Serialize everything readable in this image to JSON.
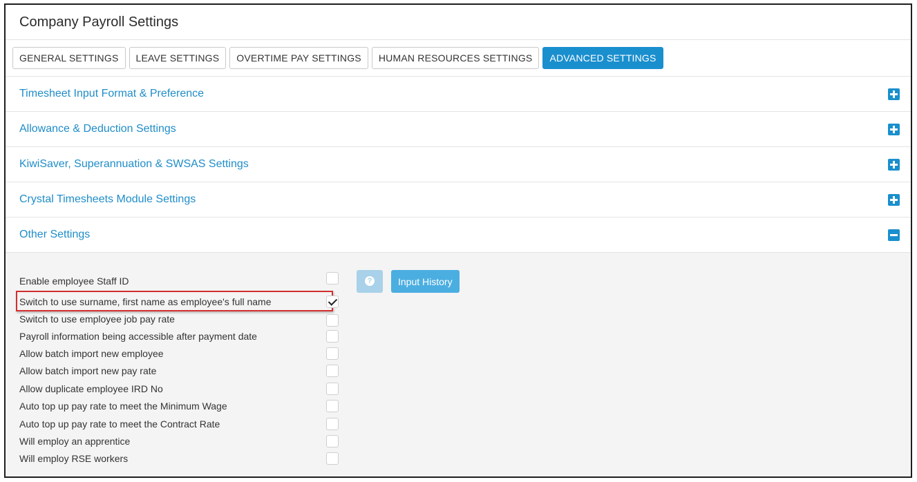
{
  "page": {
    "title": "Company Payroll Settings"
  },
  "tabs": [
    {
      "label": "GENERAL SETTINGS"
    },
    {
      "label": "LEAVE SETTINGS"
    },
    {
      "label": "OVERTIME PAY SETTINGS"
    },
    {
      "label": "HUMAN RESOURCES SETTINGS"
    },
    {
      "label": "ADVANCED SETTINGS",
      "active": true
    }
  ],
  "sections": [
    {
      "title": "Timesheet Input Format & Preference",
      "icon": "plus-icon",
      "expanded": false
    },
    {
      "title": "Allowance & Deduction Settings",
      "icon": "plus-icon",
      "expanded": false
    },
    {
      "title": "KiwiSaver, Superannuation & SWSAS Settings",
      "icon": "plus-icon",
      "expanded": false
    },
    {
      "title": "Crystal Timesheets Module Settings",
      "icon": "plus-icon",
      "expanded": false
    },
    {
      "title": "Other Settings",
      "icon": "minus-icon",
      "expanded": true
    }
  ],
  "other_settings": {
    "help_icon": "question-icon",
    "input_history_label": "Input History",
    "options": [
      {
        "label": "Enable employee Staff ID",
        "checked": false
      },
      {
        "label": "Switch to use surname, first name as employee's full name",
        "checked": true,
        "highlighted": true
      },
      {
        "label": "Switch to use employee job pay rate",
        "checked": false
      },
      {
        "label": "Payroll information being accessible after payment date",
        "checked": false
      },
      {
        "label": "Allow batch import new employee",
        "checked": false
      },
      {
        "label": "Allow batch import new pay rate",
        "checked": false
      },
      {
        "label": "Allow duplicate employee IRD No",
        "checked": false
      },
      {
        "label": "Auto top up pay rate to meet the Minimum Wage",
        "checked": false
      },
      {
        "label": "Auto top up pay rate to meet the Contract Rate",
        "checked": false
      },
      {
        "label": "Will employ an apprentice",
        "checked": false
      },
      {
        "label": "Will employ RSE workers",
        "checked": false
      }
    ]
  },
  "colors": {
    "accent": "#1a8fce",
    "section_title": "#1f8dc8",
    "highlight_border": "#d32f2f",
    "help_button": "#a9d1e9",
    "history_button": "#4baee1"
  }
}
